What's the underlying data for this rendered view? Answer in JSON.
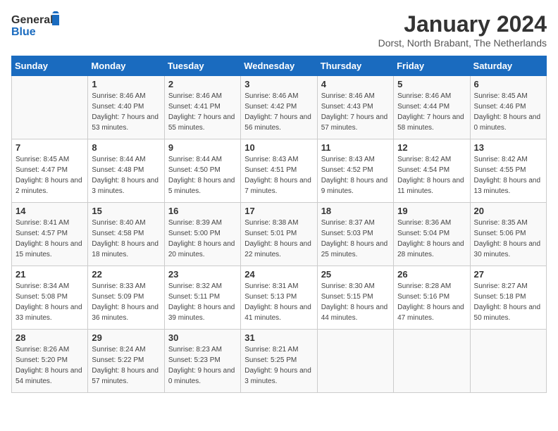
{
  "header": {
    "logo_line1": "General",
    "logo_line2": "Blue",
    "month": "January 2024",
    "location": "Dorst, North Brabant, The Netherlands"
  },
  "days_of_week": [
    "Sunday",
    "Monday",
    "Tuesday",
    "Wednesday",
    "Thursday",
    "Friday",
    "Saturday"
  ],
  "weeks": [
    [
      {
        "day": "",
        "sunrise": "",
        "sunset": "",
        "daylight": ""
      },
      {
        "day": "1",
        "sunrise": "Sunrise: 8:46 AM",
        "sunset": "Sunset: 4:40 PM",
        "daylight": "Daylight: 7 hours and 53 minutes."
      },
      {
        "day": "2",
        "sunrise": "Sunrise: 8:46 AM",
        "sunset": "Sunset: 4:41 PM",
        "daylight": "Daylight: 7 hours and 55 minutes."
      },
      {
        "day": "3",
        "sunrise": "Sunrise: 8:46 AM",
        "sunset": "Sunset: 4:42 PM",
        "daylight": "Daylight: 7 hours and 56 minutes."
      },
      {
        "day": "4",
        "sunrise": "Sunrise: 8:46 AM",
        "sunset": "Sunset: 4:43 PM",
        "daylight": "Daylight: 7 hours and 57 minutes."
      },
      {
        "day": "5",
        "sunrise": "Sunrise: 8:46 AM",
        "sunset": "Sunset: 4:44 PM",
        "daylight": "Daylight: 7 hours and 58 minutes."
      },
      {
        "day": "6",
        "sunrise": "Sunrise: 8:45 AM",
        "sunset": "Sunset: 4:46 PM",
        "daylight": "Daylight: 8 hours and 0 minutes."
      }
    ],
    [
      {
        "day": "7",
        "sunrise": "Sunrise: 8:45 AM",
        "sunset": "Sunset: 4:47 PM",
        "daylight": "Daylight: 8 hours and 2 minutes."
      },
      {
        "day": "8",
        "sunrise": "Sunrise: 8:44 AM",
        "sunset": "Sunset: 4:48 PM",
        "daylight": "Daylight: 8 hours and 3 minutes."
      },
      {
        "day": "9",
        "sunrise": "Sunrise: 8:44 AM",
        "sunset": "Sunset: 4:50 PM",
        "daylight": "Daylight: 8 hours and 5 minutes."
      },
      {
        "day": "10",
        "sunrise": "Sunrise: 8:43 AM",
        "sunset": "Sunset: 4:51 PM",
        "daylight": "Daylight: 8 hours and 7 minutes."
      },
      {
        "day": "11",
        "sunrise": "Sunrise: 8:43 AM",
        "sunset": "Sunset: 4:52 PM",
        "daylight": "Daylight: 8 hours and 9 minutes."
      },
      {
        "day": "12",
        "sunrise": "Sunrise: 8:42 AM",
        "sunset": "Sunset: 4:54 PM",
        "daylight": "Daylight: 8 hours and 11 minutes."
      },
      {
        "day": "13",
        "sunrise": "Sunrise: 8:42 AM",
        "sunset": "Sunset: 4:55 PM",
        "daylight": "Daylight: 8 hours and 13 minutes."
      }
    ],
    [
      {
        "day": "14",
        "sunrise": "Sunrise: 8:41 AM",
        "sunset": "Sunset: 4:57 PM",
        "daylight": "Daylight: 8 hours and 15 minutes."
      },
      {
        "day": "15",
        "sunrise": "Sunrise: 8:40 AM",
        "sunset": "Sunset: 4:58 PM",
        "daylight": "Daylight: 8 hours and 18 minutes."
      },
      {
        "day": "16",
        "sunrise": "Sunrise: 8:39 AM",
        "sunset": "Sunset: 5:00 PM",
        "daylight": "Daylight: 8 hours and 20 minutes."
      },
      {
        "day": "17",
        "sunrise": "Sunrise: 8:38 AM",
        "sunset": "Sunset: 5:01 PM",
        "daylight": "Daylight: 8 hours and 22 minutes."
      },
      {
        "day": "18",
        "sunrise": "Sunrise: 8:37 AM",
        "sunset": "Sunset: 5:03 PM",
        "daylight": "Daylight: 8 hours and 25 minutes."
      },
      {
        "day": "19",
        "sunrise": "Sunrise: 8:36 AM",
        "sunset": "Sunset: 5:04 PM",
        "daylight": "Daylight: 8 hours and 28 minutes."
      },
      {
        "day": "20",
        "sunrise": "Sunrise: 8:35 AM",
        "sunset": "Sunset: 5:06 PM",
        "daylight": "Daylight: 8 hours and 30 minutes."
      }
    ],
    [
      {
        "day": "21",
        "sunrise": "Sunrise: 8:34 AM",
        "sunset": "Sunset: 5:08 PM",
        "daylight": "Daylight: 8 hours and 33 minutes."
      },
      {
        "day": "22",
        "sunrise": "Sunrise: 8:33 AM",
        "sunset": "Sunset: 5:09 PM",
        "daylight": "Daylight: 8 hours and 36 minutes."
      },
      {
        "day": "23",
        "sunrise": "Sunrise: 8:32 AM",
        "sunset": "Sunset: 5:11 PM",
        "daylight": "Daylight: 8 hours and 39 minutes."
      },
      {
        "day": "24",
        "sunrise": "Sunrise: 8:31 AM",
        "sunset": "Sunset: 5:13 PM",
        "daylight": "Daylight: 8 hours and 41 minutes."
      },
      {
        "day": "25",
        "sunrise": "Sunrise: 8:30 AM",
        "sunset": "Sunset: 5:15 PM",
        "daylight": "Daylight: 8 hours and 44 minutes."
      },
      {
        "day": "26",
        "sunrise": "Sunrise: 8:28 AM",
        "sunset": "Sunset: 5:16 PM",
        "daylight": "Daylight: 8 hours and 47 minutes."
      },
      {
        "day": "27",
        "sunrise": "Sunrise: 8:27 AM",
        "sunset": "Sunset: 5:18 PM",
        "daylight": "Daylight: 8 hours and 50 minutes."
      }
    ],
    [
      {
        "day": "28",
        "sunrise": "Sunrise: 8:26 AM",
        "sunset": "Sunset: 5:20 PM",
        "daylight": "Daylight: 8 hours and 54 minutes."
      },
      {
        "day": "29",
        "sunrise": "Sunrise: 8:24 AM",
        "sunset": "Sunset: 5:22 PM",
        "daylight": "Daylight: 8 hours and 57 minutes."
      },
      {
        "day": "30",
        "sunrise": "Sunrise: 8:23 AM",
        "sunset": "Sunset: 5:23 PM",
        "daylight": "Daylight: 9 hours and 0 minutes."
      },
      {
        "day": "31",
        "sunrise": "Sunrise: 8:21 AM",
        "sunset": "Sunset: 5:25 PM",
        "daylight": "Daylight: 9 hours and 3 minutes."
      },
      {
        "day": "",
        "sunrise": "",
        "sunset": "",
        "daylight": ""
      },
      {
        "day": "",
        "sunrise": "",
        "sunset": "",
        "daylight": ""
      },
      {
        "day": "",
        "sunrise": "",
        "sunset": "",
        "daylight": ""
      }
    ]
  ]
}
